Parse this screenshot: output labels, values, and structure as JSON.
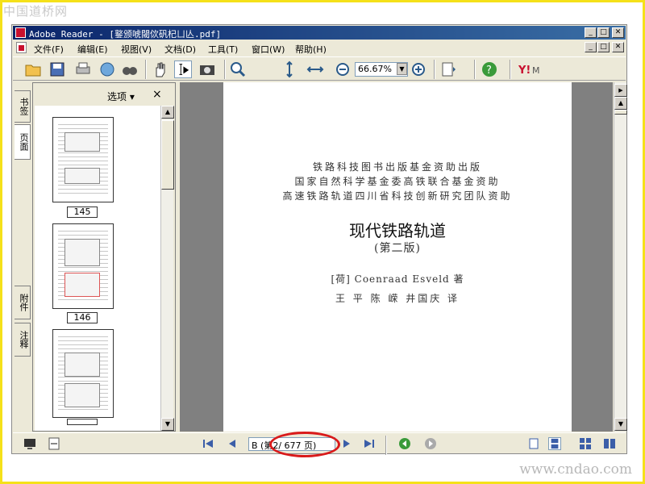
{
  "watermark_top": "中国道桥网",
  "watermark_bottom": "www.cndao.com",
  "window": {
    "title": "Adobe Reader - [鐜颁唬閾佽矾杞ㄩ亾.pdf]",
    "controls": {
      "minimize": "_",
      "maximize": "□",
      "close": "✕"
    }
  },
  "menu": [
    "文件(F)",
    "编辑(E)",
    "视图(V)",
    "文档(D)",
    "工具(T)",
    "窗口(W)",
    "帮助(H)"
  ],
  "toolbar": {
    "zoom_value": "66.67%"
  },
  "left_tabs": [
    "书签",
    "页面",
    "附件",
    "注释"
  ],
  "panel": {
    "options_label": "选项 ▾",
    "close": "×"
  },
  "thumbnails": [
    {
      "label": "145"
    },
    {
      "label": "146"
    },
    {
      "label": ""
    }
  ],
  "page": {
    "funding_lines": [
      "铁路科技图书出版基金资助出版",
      "国家自然科学基金委高铁联合基金资助",
      "高速铁路轨道四川省科技创新研究团队资助"
    ],
    "book_title": "现代铁路轨道",
    "edition": "(第二版)",
    "author": "[荷] Coenraad Esveld  著",
    "translators": "王 平 陈 嵘 井国庆 译"
  },
  "status": {
    "page_field": "B (第2/ 677 页)"
  },
  "colors": {
    "highlight_oval": "#d91a1a",
    "title_bar": "#0a246a",
    "frame": "#f5e11a"
  }
}
